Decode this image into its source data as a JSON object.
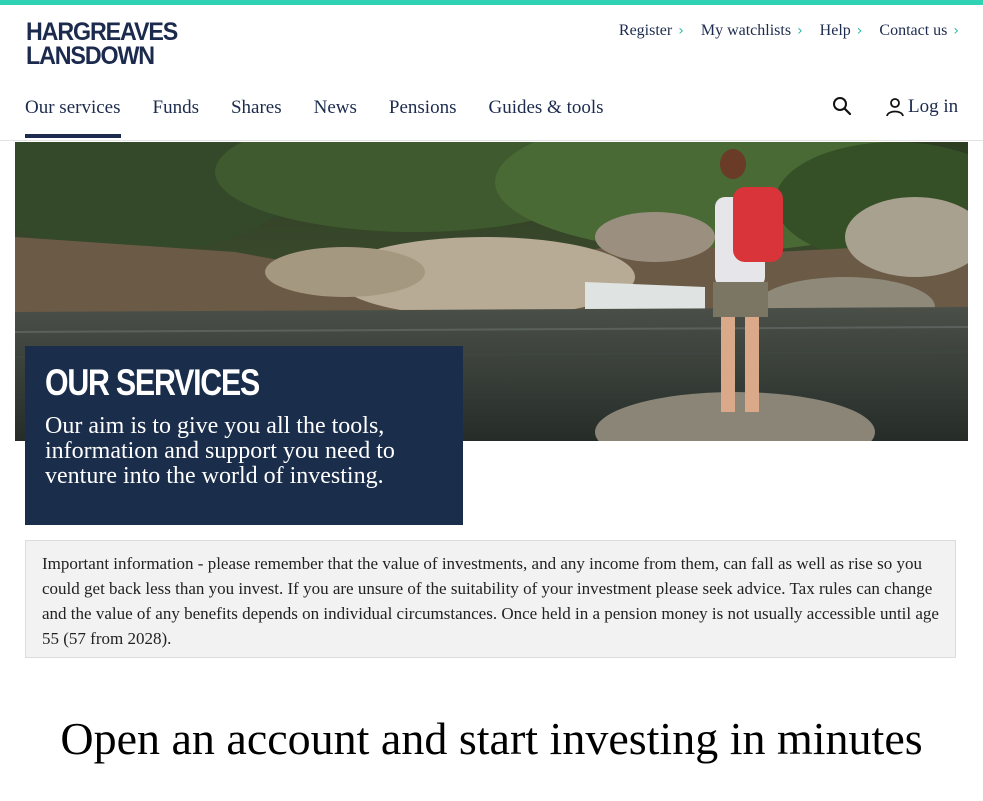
{
  "brand": {
    "line1": "HARGREAVES",
    "line2": "LANSDOWN"
  },
  "utility_nav": [
    {
      "label": "Register"
    },
    {
      "label": "My watchlists"
    },
    {
      "label": "Help"
    },
    {
      "label": "Contact us"
    }
  ],
  "main_nav": [
    {
      "label": "Our services",
      "active": true
    },
    {
      "label": "Funds"
    },
    {
      "label": "Shares"
    },
    {
      "label": "News"
    },
    {
      "label": "Pensions"
    },
    {
      "label": "Guides & tools"
    }
  ],
  "header_actions": {
    "search_icon": "search-icon",
    "login_label": "Log in",
    "user_icon": "user-icon"
  },
  "hero": {
    "title": "OUR SERVICES",
    "subtitle": "Our aim is to give you all the tools, information and support you need to venture into the world of investing."
  },
  "notice": {
    "text": "Important information - please remember that the value of investments, and any income from them, can fall as well as rise so you could get back less than you invest. If you are unsure of the suitability of your investment please seek advice. Tax rules can change and the value of any benefits depends on individual circumstances. Once held in a pension money is not usually accessible until age 55 (57 from 2028)."
  },
  "section": {
    "title": "Open an account and start investing in minutes"
  },
  "colors": {
    "accent": "#2fd3b3",
    "navy": "#1a2d4b"
  }
}
